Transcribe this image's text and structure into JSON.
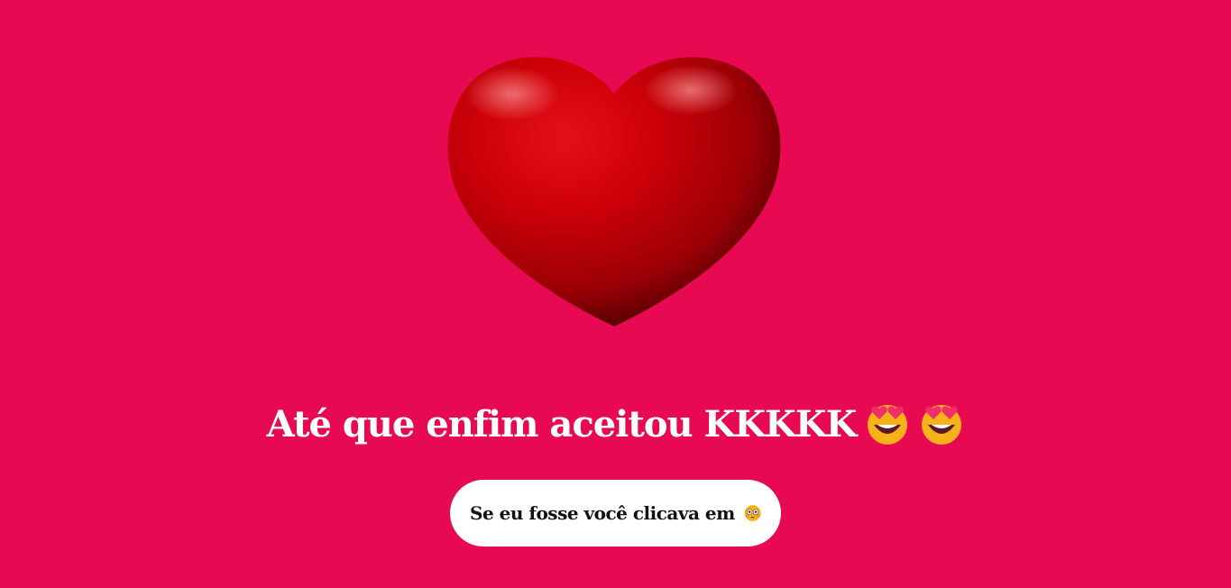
{
  "background_color": "#e70a52",
  "heart": {
    "icon": "red-heart-3d",
    "color": "#d4000f"
  },
  "headline": {
    "text": "Até que enfim aceitou KKKKK",
    "emojis": [
      "star-struck-heart-eyes-emoji",
      "star-struck-heart-eyes-emoji"
    ]
  },
  "cta": {
    "label": "Se eu fosse você clicava em",
    "emoji": "flushed-face-emoji"
  }
}
